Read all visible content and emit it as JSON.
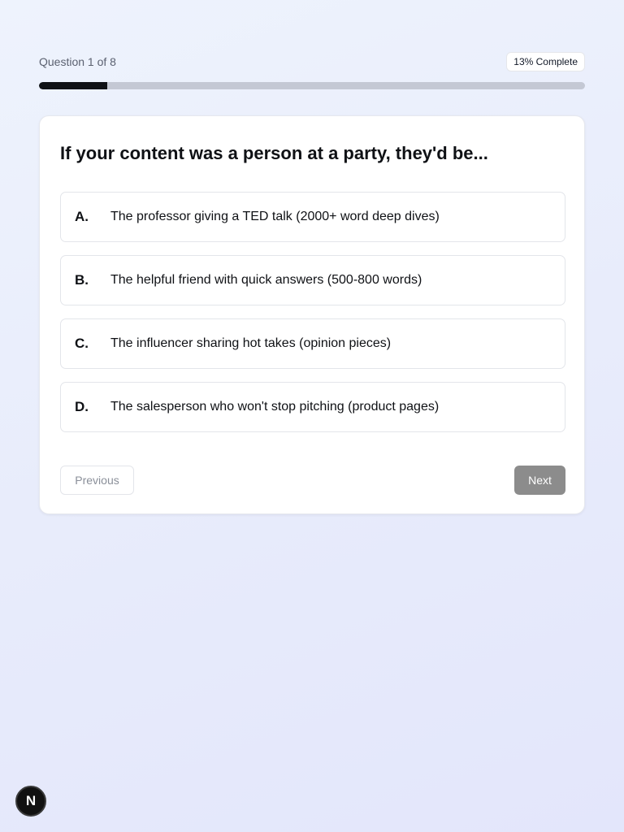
{
  "header": {
    "question_label": "Question 1 of 8",
    "complete_label": "13% Complete",
    "progress_fraction": 0.125
  },
  "card": {
    "question": "If your content was a person at a party, they'd be...",
    "options": [
      {
        "letter": "A.",
        "text": "The professor giving a TED talk (2000+ word deep dives)"
      },
      {
        "letter": "B.",
        "text": "The helpful friend with quick answers (500-800 words)"
      },
      {
        "letter": "C.",
        "text": "The influencer sharing hot takes (opinion pieces)"
      },
      {
        "letter": "D.",
        "text": "The salesperson who won't stop pitching (product pages)"
      }
    ],
    "previous_label": "Previous",
    "next_label": "Next"
  },
  "corner_badge": {
    "letter": "N",
    "icon": "n-logo-icon"
  },
  "colors": {
    "progress_fill": "#0f1115",
    "progress_track": "#c4c8d4",
    "next_button": "#8c8c8c"
  }
}
